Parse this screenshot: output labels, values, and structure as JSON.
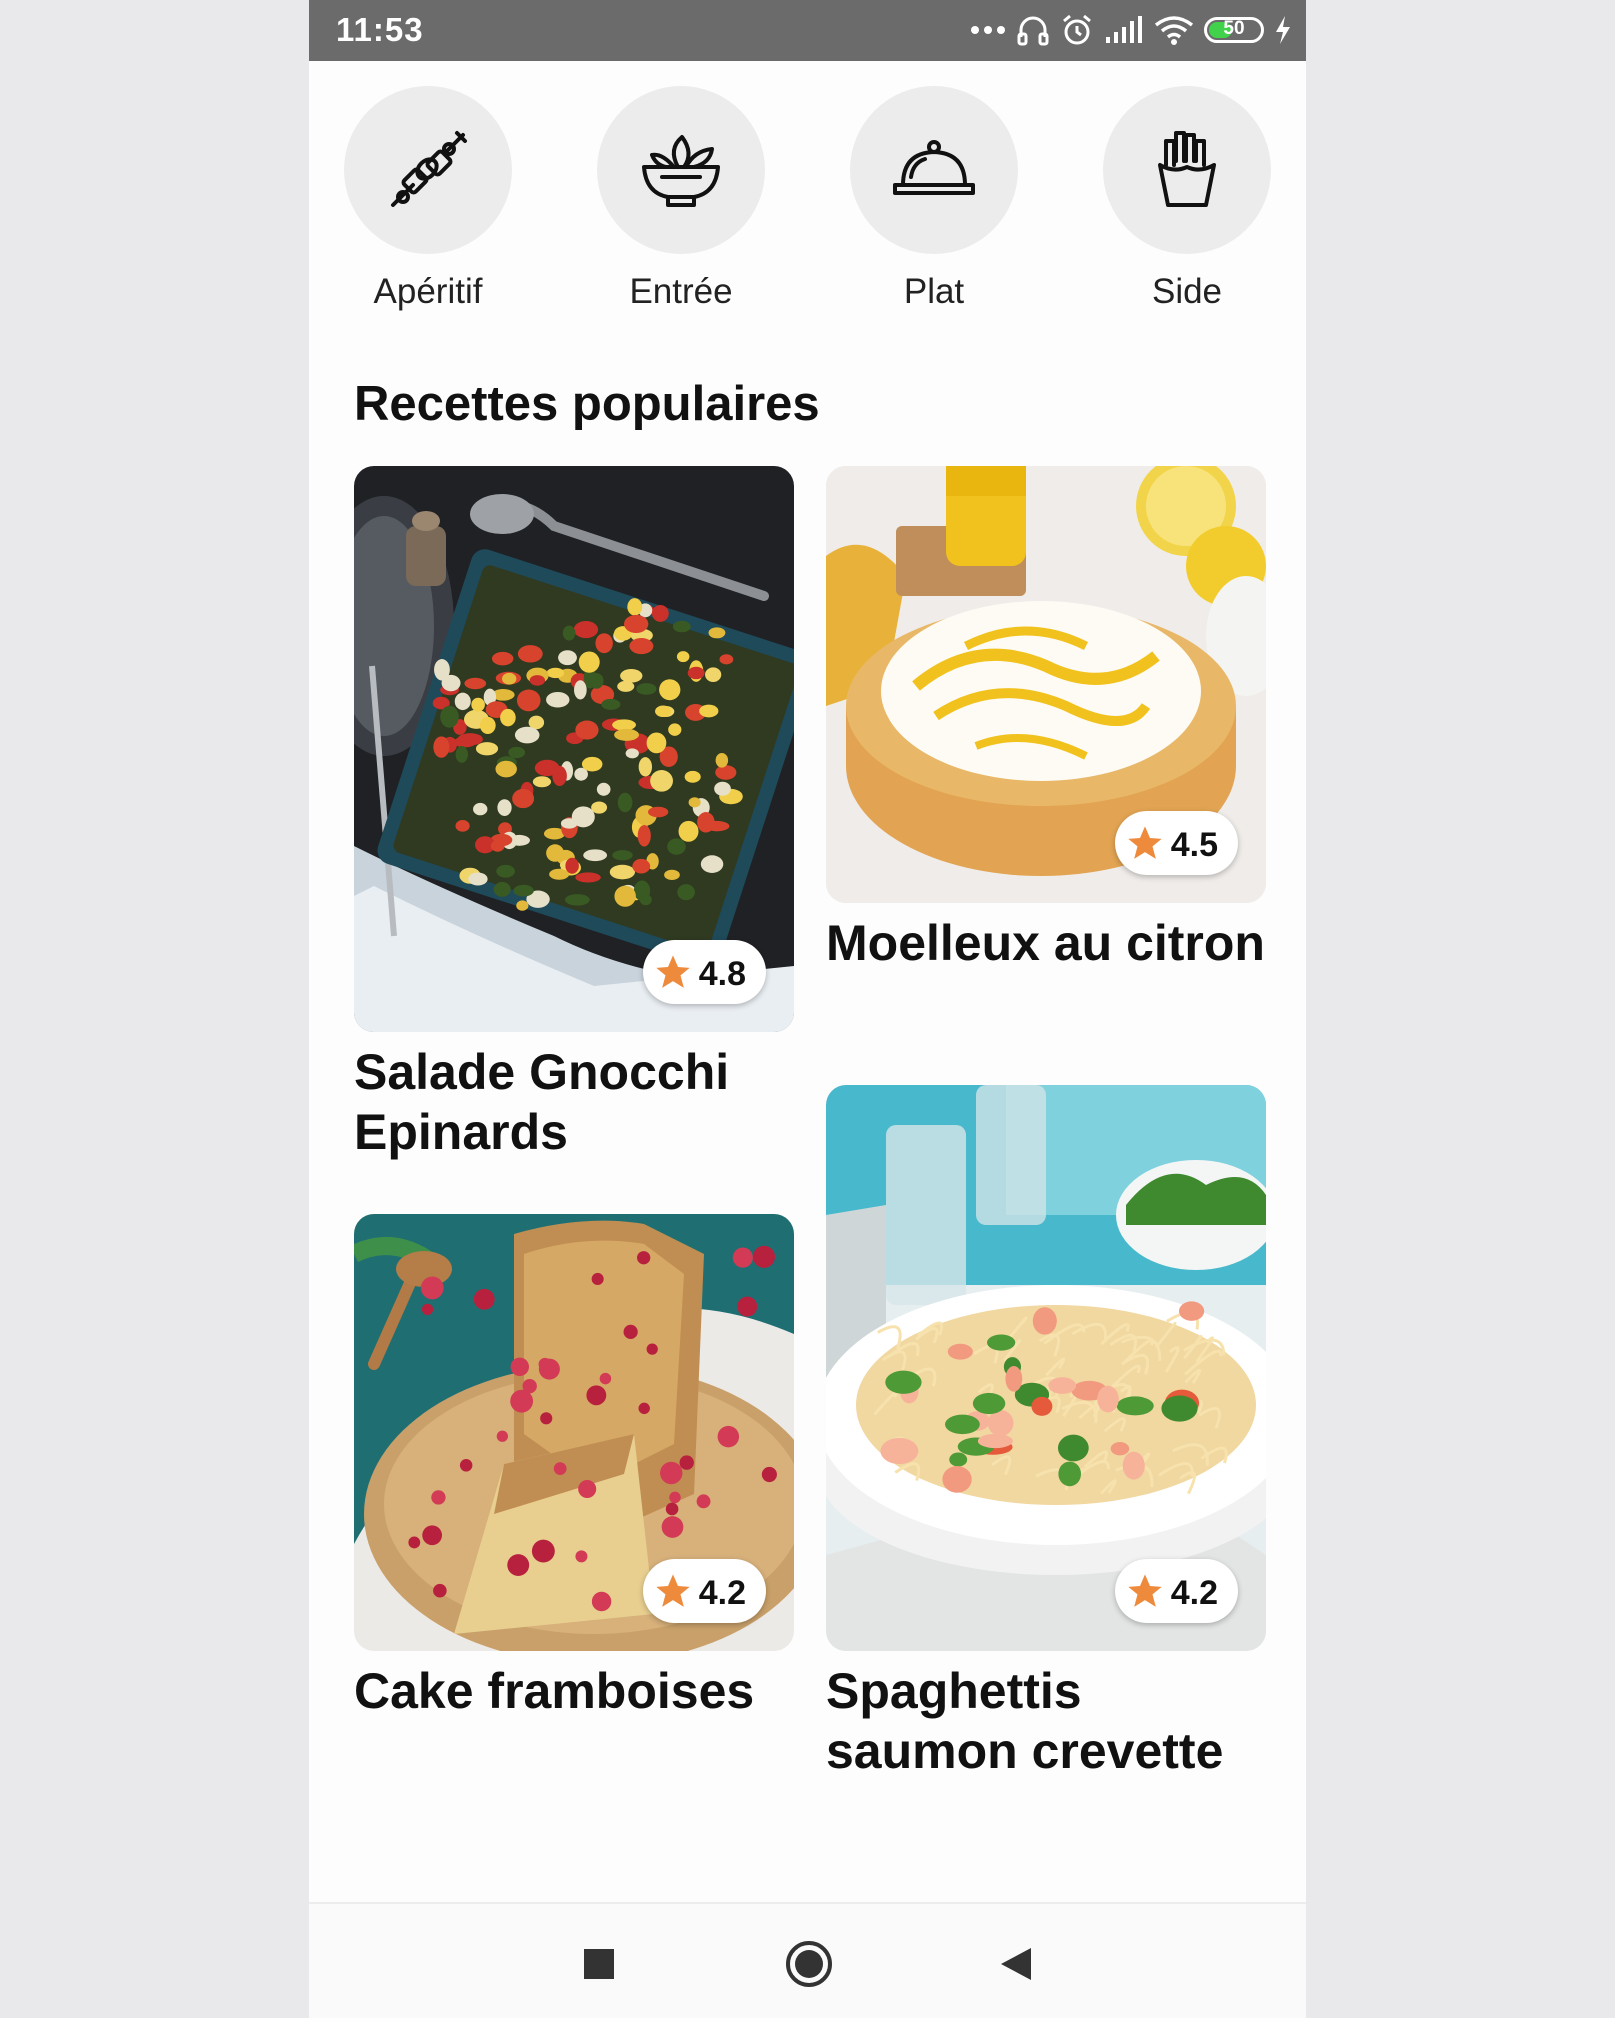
{
  "status_bar": {
    "time": "11:53",
    "battery_level": "50",
    "battery_fraction": 0.5,
    "accent": "#3fd24a"
  },
  "categories": [
    {
      "label": "Apéritif",
      "icon": "skewer-icon"
    },
    {
      "label": "Entrée",
      "icon": "salad-bowl-icon"
    },
    {
      "label": "Plat",
      "icon": "cloche-icon"
    },
    {
      "label": "Side",
      "icon": "fries-icon"
    }
  ],
  "section": {
    "title": "Recettes populaires"
  },
  "recipes": [
    {
      "title": "Salade Gnocchi Epinards",
      "rating": "4.8"
    },
    {
      "title": "Moelleux au citron",
      "rating": "4.5"
    },
    {
      "title": "Cake framboises",
      "rating": "4.2"
    },
    {
      "title": "Spaghettis saumon crevette",
      "rating": "4.2"
    }
  ],
  "colors": {
    "star": "#ee8a3c",
    "category_bg": "#ececec"
  },
  "navigation": {
    "buttons": [
      "square-recents-icon",
      "circle-home-icon",
      "triangle-back-icon"
    ]
  }
}
